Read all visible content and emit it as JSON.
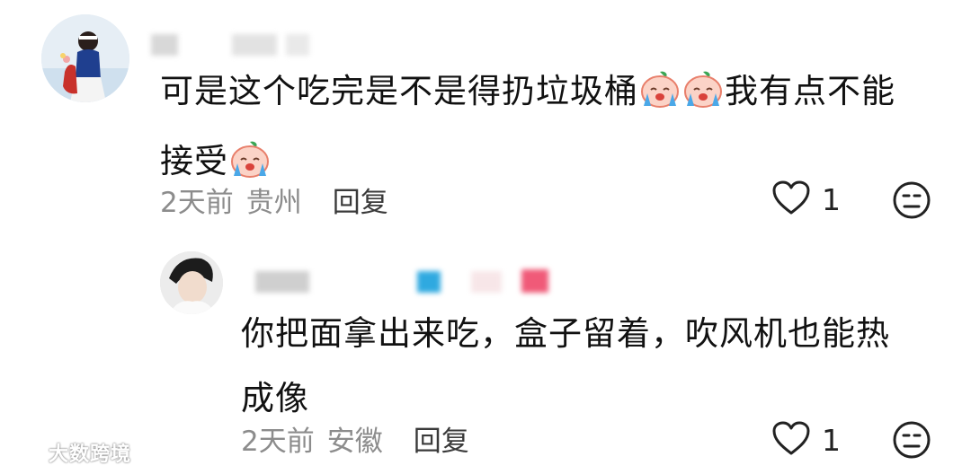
{
  "comments": [
    {
      "text_line1": "可是这个吃完是不是得扔垃圾桶",
      "text_line1_after": "我有点不能",
      "text_line2": "接受",
      "time": "2天前",
      "region": "贵州",
      "reply_label": "回复",
      "like_count": "1",
      "emojis": [
        "crying-peach-emoji",
        "crying-peach-emoji",
        "crying-peach-emoji"
      ]
    },
    {
      "text_line1": "你把面拿出来吃，盒子留着，吹风机也能热",
      "text_line2": "成像",
      "time": "2天前",
      "region": "安徽",
      "reply_label": "回复",
      "like_count": "1"
    }
  ],
  "watermark": {
    "text": "大数跨境"
  },
  "icons": {
    "like": "heart-outline-icon",
    "dislike": "neutral-face-icon"
  },
  "colors": {
    "meta_text": "#8c8c8c",
    "reply_text": "#3a3a3a",
    "blur_gray": "#cfcfcf",
    "blur_blue": "#2fa9e0",
    "blur_pink": "#f05a78"
  }
}
